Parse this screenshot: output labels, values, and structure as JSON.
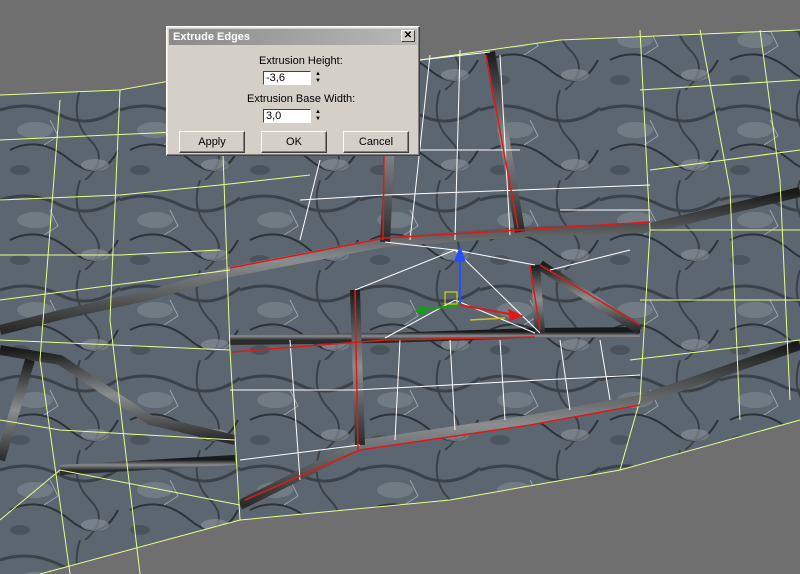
{
  "dialog": {
    "title": "Extrude Edges",
    "close_glyph": "✕",
    "height_label": "Extrusion Height:",
    "height_value": "-3,6",
    "width_label": "Extrusion Base Width:",
    "width_value": "3,0",
    "apply_label": "Apply",
    "ok_label": "OK",
    "cancel_label": "Cancel"
  },
  "gizmo": {
    "x_axis_color": "#e01818",
    "y_axis_color": "#2050ff",
    "z_axis_color": "#10a010"
  },
  "viewport": {
    "background": "#6f6f6f",
    "wire_color": "#e6ff8c",
    "edge_color": "#ffffff",
    "selected_edge_color": "#e01818"
  }
}
